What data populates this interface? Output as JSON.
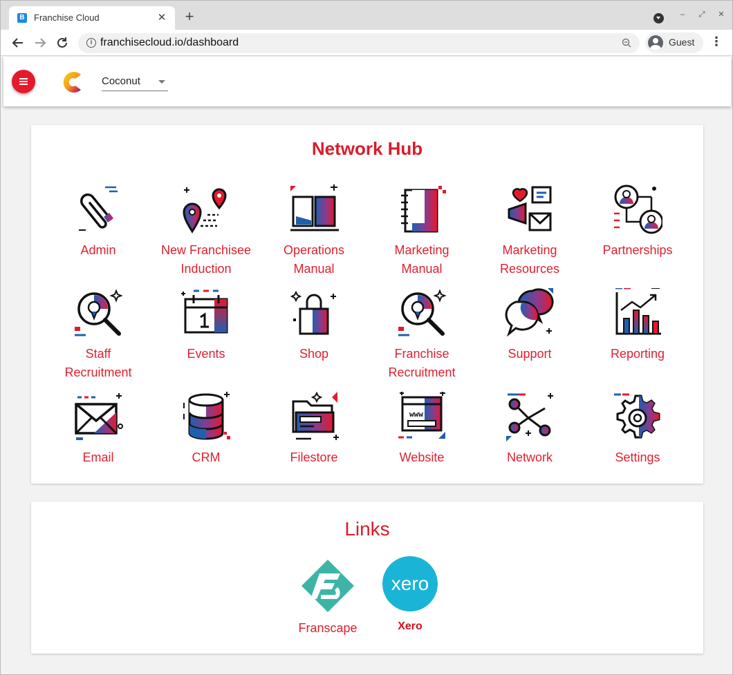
{
  "browser": {
    "tab_title": "Franchise Cloud",
    "tab_favicon_letter": "B",
    "url": "franchisecloud.io/dashboard",
    "profile_label": "Guest"
  },
  "header": {
    "franchise_select_value": "Coconut"
  },
  "network_hub": {
    "title": "Network Hub",
    "tiles": [
      {
        "label_1": "Admin",
        "label_2": "",
        "icon": "paperclip-icon"
      },
      {
        "label_1": "New Franchisee",
        "label_2": "Induction",
        "icon": "map-pins-icon"
      },
      {
        "label_1": "Operations",
        "label_2": "Manual",
        "icon": "open-book-icon"
      },
      {
        "label_1": "Marketing",
        "label_2": "Manual",
        "icon": "notebook-icon"
      },
      {
        "label_1": "Marketing",
        "label_2": "Resources",
        "icon": "megaphone-icon"
      },
      {
        "label_1": "Partnerships",
        "label_2": "",
        "icon": "people-network-icon"
      },
      {
        "label_1": "Staff",
        "label_2": "Recruitment",
        "icon": "magnifier-person-icon"
      },
      {
        "label_1": "Events",
        "label_2": "",
        "icon": "calendar-icon"
      },
      {
        "label_1": "Shop",
        "label_2": "",
        "icon": "shopping-bag-icon"
      },
      {
        "label_1": "Franchise",
        "label_2": "Recruitment",
        "icon": "magnifier-person-icon"
      },
      {
        "label_1": "Support",
        "label_2": "",
        "icon": "chat-bubbles-icon"
      },
      {
        "label_1": "Reporting",
        "label_2": "",
        "icon": "bar-chart-icon"
      },
      {
        "label_1": "Email",
        "label_2": "",
        "icon": "envelope-icon"
      },
      {
        "label_1": "CRM",
        "label_2": "",
        "icon": "database-icon"
      },
      {
        "label_1": "Filestore",
        "label_2": "",
        "icon": "folder-icon"
      },
      {
        "label_1": "Website",
        "label_2": "",
        "icon": "browser-window-icon"
      },
      {
        "label_1": "Network",
        "label_2": "",
        "icon": "share-nodes-icon"
      },
      {
        "label_1": "Settings",
        "label_2": "",
        "icon": "gear-icon"
      }
    ]
  },
  "links": {
    "title": "Links",
    "items": [
      {
        "label": "Franscape",
        "icon": "franscape-logo-icon"
      },
      {
        "label": "Xero",
        "icon": "xero-logo-icon",
        "logo_text": "xero"
      }
    ]
  },
  "colors": {
    "accent_red": "#e0202f",
    "accent_blue": "#1f5fb0",
    "franscape_teal": "#3db5a6",
    "xero_blue": "#1ab4d7"
  }
}
